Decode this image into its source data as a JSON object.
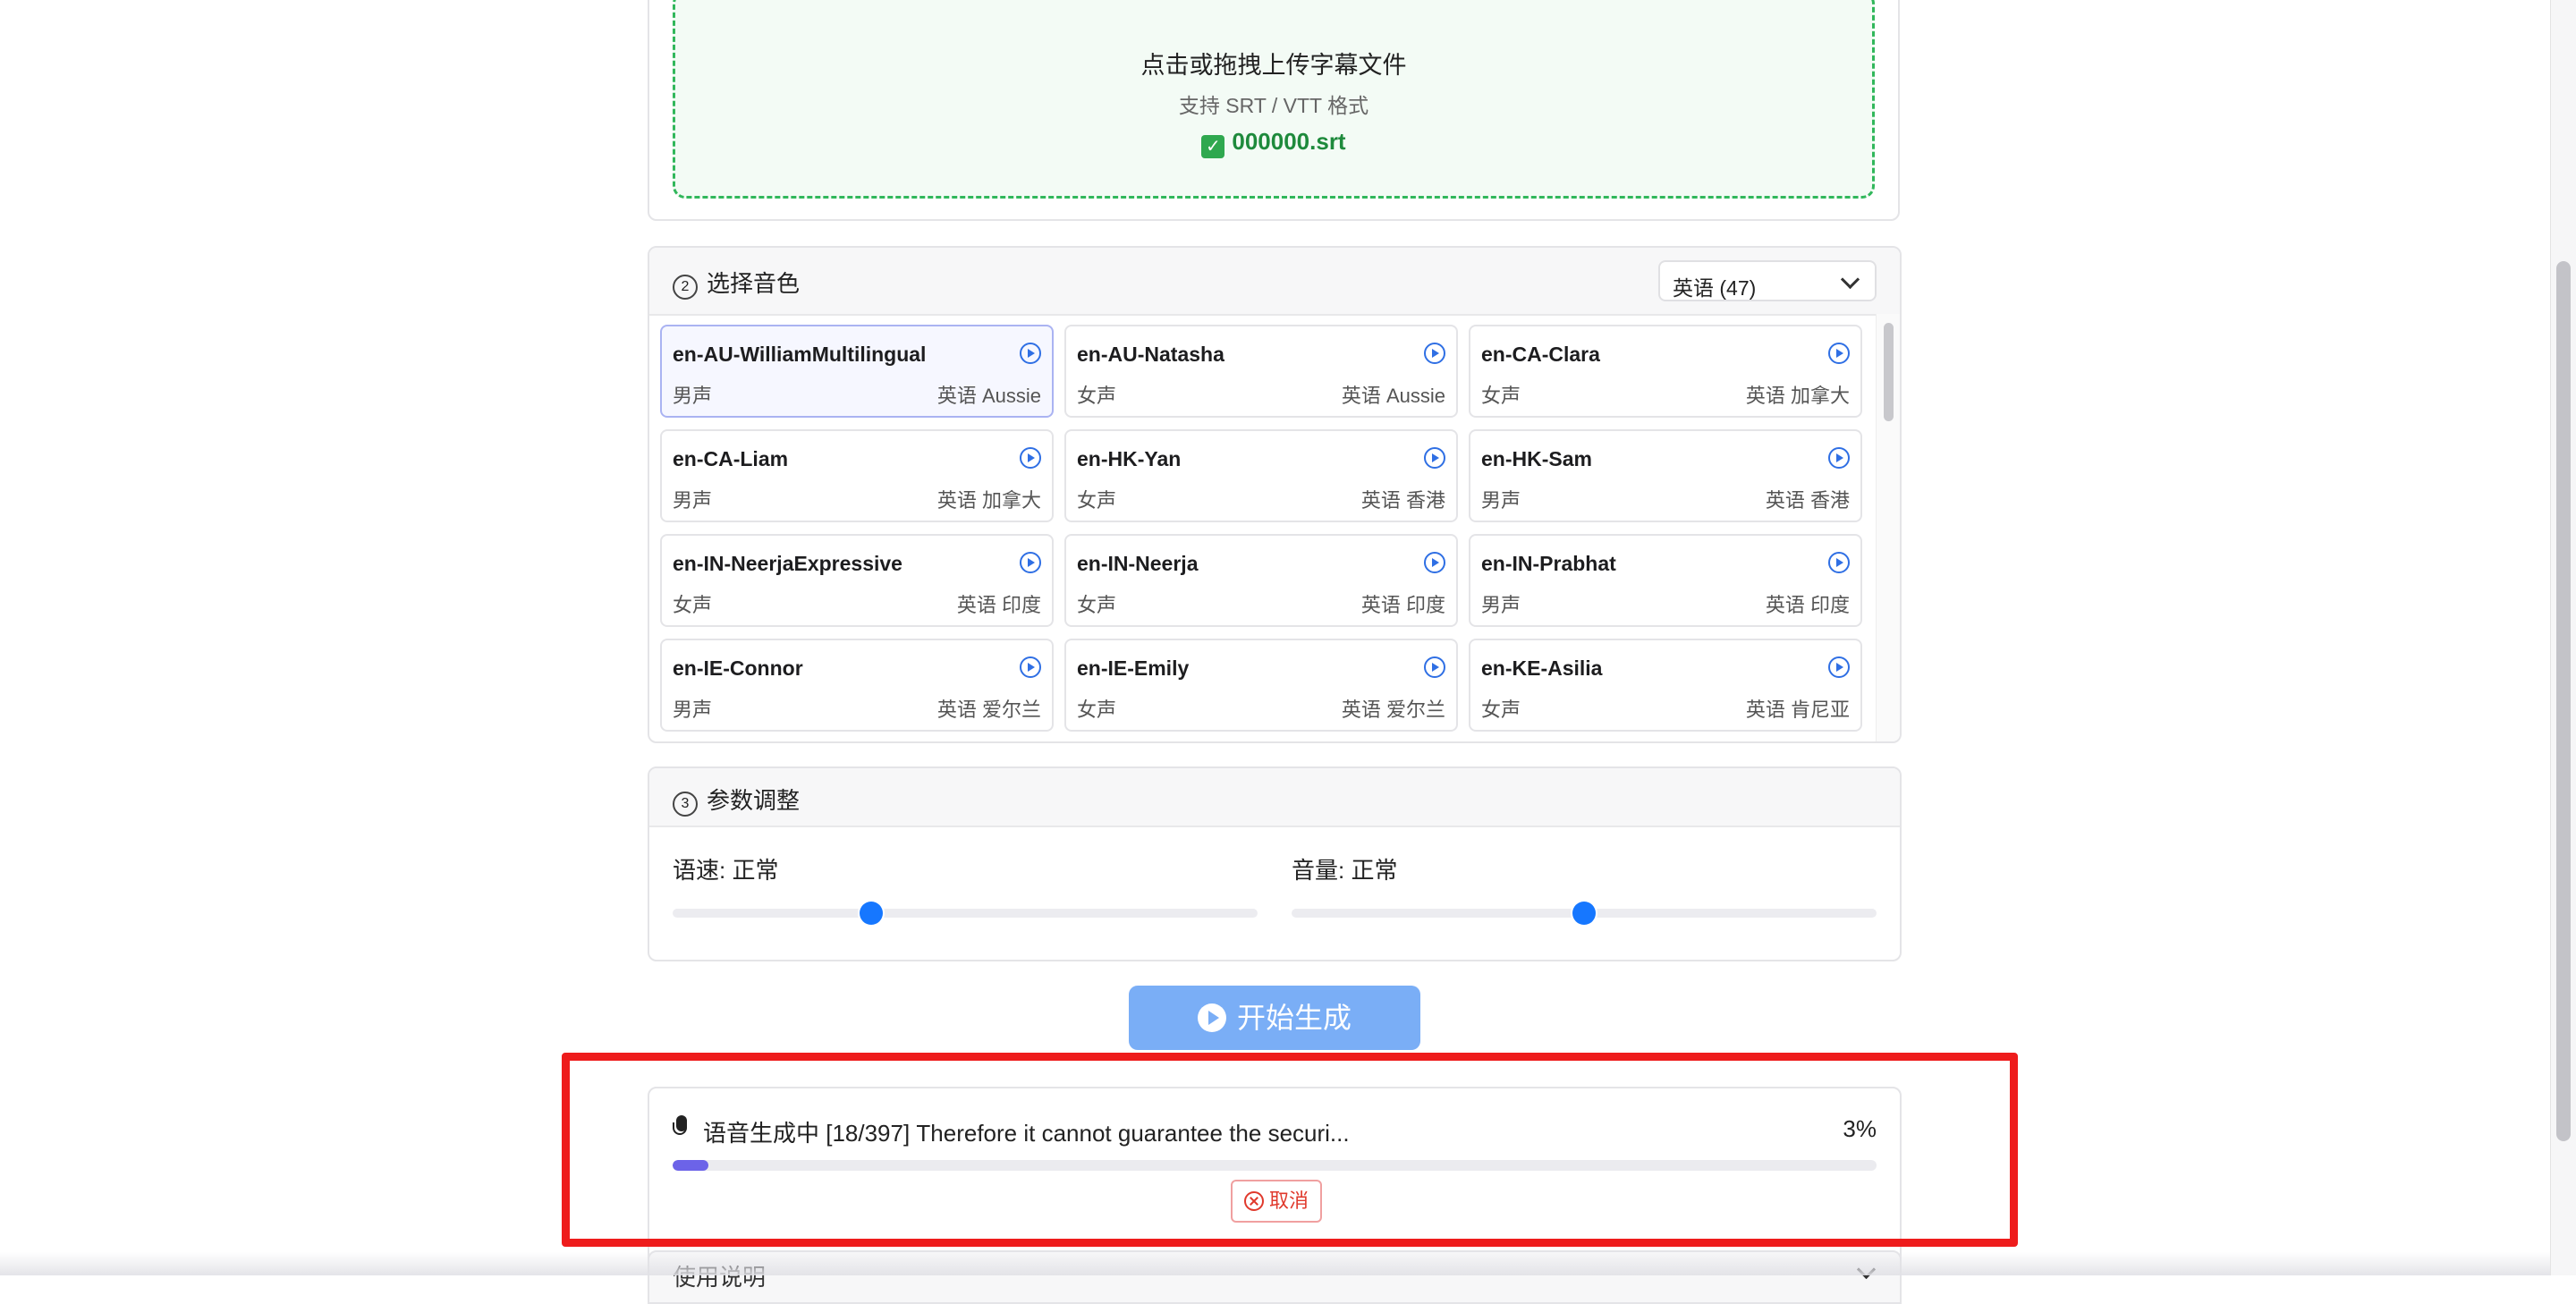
{
  "upload": {
    "title": "点击或拖拽上传字幕文件",
    "hint": "支持 SRT / VTT 格式",
    "file_check": "✓",
    "file_name": "000000.srt"
  },
  "voice_section": {
    "number": "2",
    "title": "选择音色",
    "language_select": "英语 (47)",
    "voices": [
      {
        "name": "en-AU-WilliamMultilingual",
        "gender": "男声",
        "locale": "英语 Aussie",
        "selected": true
      },
      {
        "name": "en-AU-Natasha",
        "gender": "女声",
        "locale": "英语 Aussie"
      },
      {
        "name": "en-CA-Clara",
        "gender": "女声",
        "locale": "英语 加拿大"
      },
      {
        "name": "en-CA-Liam",
        "gender": "男声",
        "locale": "英语 加拿大"
      },
      {
        "name": "en-HK-Yan",
        "gender": "女声",
        "locale": "英语 香港"
      },
      {
        "name": "en-HK-Sam",
        "gender": "男声",
        "locale": "英语 香港"
      },
      {
        "name": "en-IN-NeerjaExpressive",
        "gender": "女声",
        "locale": "英语 印度"
      },
      {
        "name": "en-IN-Neerja",
        "gender": "女声",
        "locale": "英语 印度"
      },
      {
        "name": "en-IN-Prabhat",
        "gender": "男声",
        "locale": "英语 印度"
      },
      {
        "name": "en-IE-Connor",
        "gender": "男声",
        "locale": "英语 爱尔兰"
      },
      {
        "name": "en-IE-Emily",
        "gender": "女声",
        "locale": "英语 爱尔兰"
      },
      {
        "name": "en-KE-Asilia",
        "gender": "女声",
        "locale": "英语 肯尼亚"
      }
    ]
  },
  "params_section": {
    "number": "3",
    "title": "参数调整",
    "speed_label": "语速: 正常",
    "speed_value": 0.34,
    "volume_label": "音量: 正常",
    "volume_value": 0.5
  },
  "generate_button": "开始生成",
  "progress": {
    "text": "语音生成中 [18/397] Therefore it cannot guarantee the securi...",
    "percent_label": "3%",
    "percent": 0.03,
    "cancel_label": "取消"
  },
  "usage_section": {
    "title_partial": "使用说明"
  },
  "colors": {
    "accent": "#1677ff",
    "progress": "#6c63e8",
    "upload_border": "#31b75b",
    "highlight": "#ee1c1c"
  }
}
